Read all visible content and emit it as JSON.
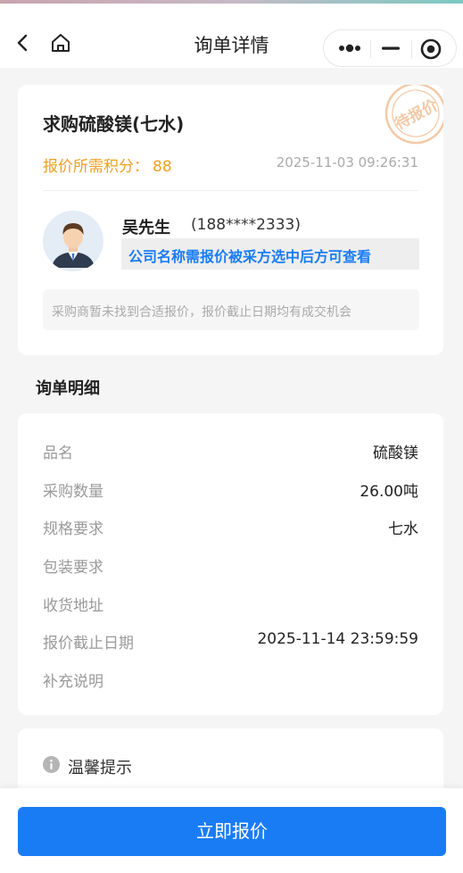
{
  "header": {
    "title": "询单详情"
  },
  "inquiry": {
    "product_title": "求购硫酸镁(七水)",
    "status_stamp": "待报价",
    "points_label": "报价所需积分：",
    "points_value": "88",
    "time": "2025-11-03 09:26:31",
    "buyer_name": "吴先生",
    "buyer_phone": "(188****2333)",
    "company_notice": "公司名称需报价被采方选中后方可查看",
    "notice": "采购商暂未找到合适报价，报价截止日期均有成交机会"
  },
  "details": {
    "section_title": "询单明细",
    "rows": [
      {
        "label": "品名",
        "value": "硫酸镁"
      },
      {
        "label": "采购数量",
        "value": "26.00吨"
      },
      {
        "label": "规格要求",
        "value": "七水"
      },
      {
        "label": "包装要求",
        "value": ""
      },
      {
        "label": "收货地址",
        "value": ""
      },
      {
        "label": "报价截止日期",
        "value": "2025-11-14 23:59:59"
      },
      {
        "label": "补充说明",
        "value": ""
      }
    ]
  },
  "tips": {
    "label": "温馨提示"
  },
  "footer": {
    "button_label": "立即报价"
  },
  "colors": {
    "primary": "#1a7cf5",
    "points": "#f0a020",
    "stamp": "#f3c9a6"
  }
}
